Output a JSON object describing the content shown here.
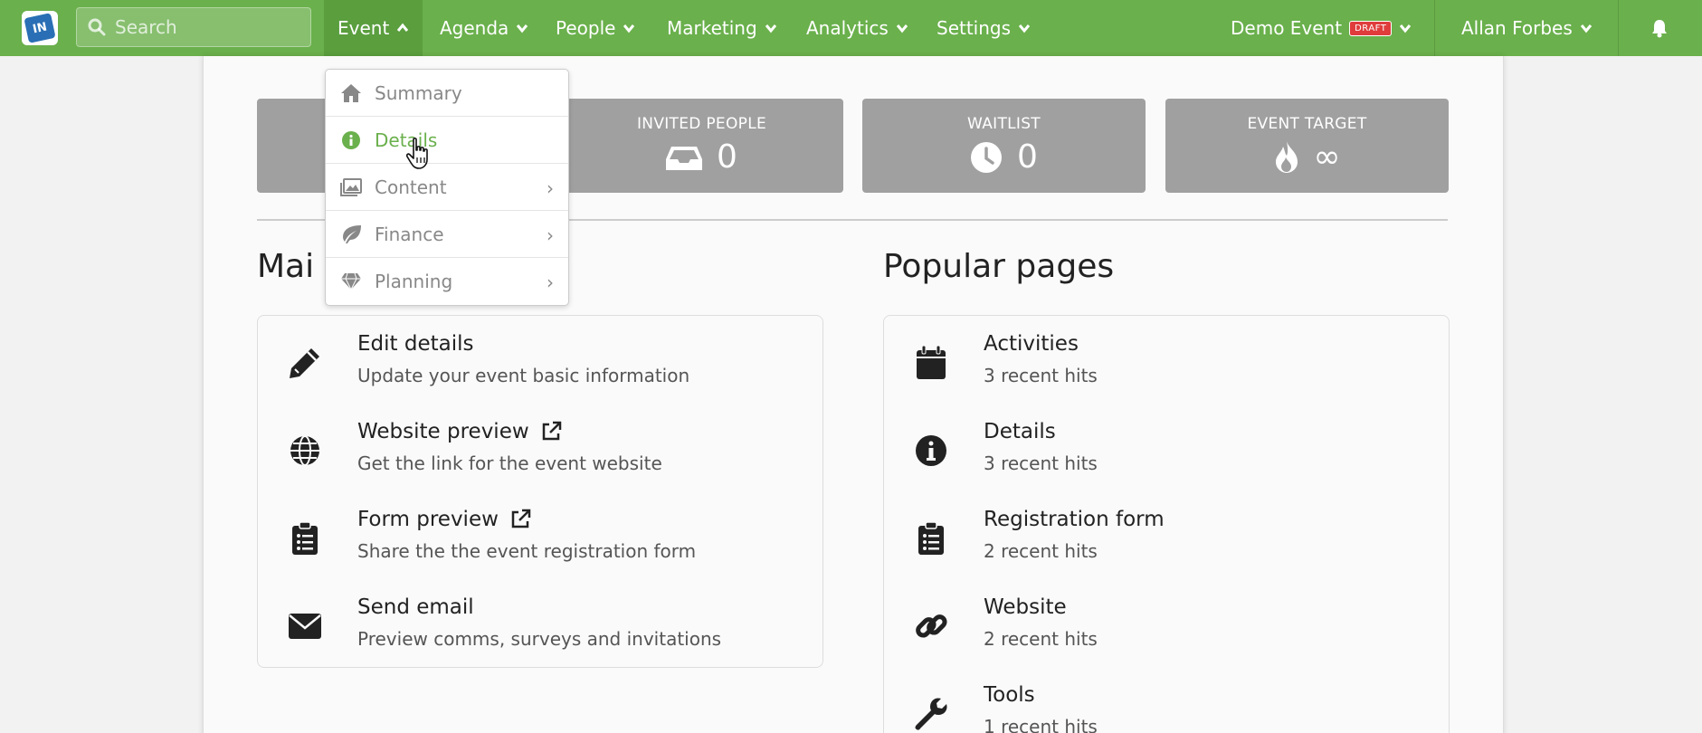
{
  "nav": {
    "search_placeholder": "Search",
    "items": [
      {
        "label": "Event"
      },
      {
        "label": "Agenda"
      },
      {
        "label": "People"
      },
      {
        "label": "Marketing"
      },
      {
        "label": "Analytics"
      },
      {
        "label": "Settings"
      }
    ],
    "event_name": "Demo Event",
    "event_badge": "DRAFT",
    "user_name": "Allan Forbes"
  },
  "dropdown": {
    "items": [
      {
        "label": "Summary",
        "icon": "home-icon"
      },
      {
        "label": "Details",
        "icon": "info-icon"
      },
      {
        "label": "Content",
        "icon": "image-icon"
      },
      {
        "label": "Finance",
        "icon": "leaf-icon"
      },
      {
        "label": "Planning",
        "icon": "diamond-icon"
      }
    ]
  },
  "stats": [
    {
      "label": "INVITED PEOPLE",
      "value": "0",
      "icon": "inbox-icon"
    },
    {
      "label": "WAITLIST",
      "value": "0",
      "icon": "clock-icon"
    },
    {
      "label": "EVENT TARGET",
      "value": "∞",
      "icon": "fire-icon"
    }
  ],
  "main_actions": {
    "title": "Mai",
    "items": [
      {
        "title": "Edit details",
        "subtitle": "Update your event basic information",
        "icon": "pencil-icon"
      },
      {
        "title": "Website preview",
        "subtitle": "Get the link for the event website",
        "icon": "globe-icon"
      },
      {
        "title": "Form preview",
        "subtitle": "Share the the event registration form",
        "icon": "clipboard-icon"
      },
      {
        "title": "Send email",
        "subtitle": "Preview comms, surveys and invitations",
        "icon": "envelope-icon"
      }
    ]
  },
  "popular_pages": {
    "title": "Popular pages",
    "items": [
      {
        "title": "Activities",
        "subtitle": "3 recent hits",
        "icon": "calendar-icon"
      },
      {
        "title": "Details",
        "subtitle": "3 recent hits",
        "icon": "info-icon"
      },
      {
        "title": "Registration form",
        "subtitle": "2 recent hits",
        "icon": "clipboard-icon"
      },
      {
        "title": "Website",
        "subtitle": "2 recent hits",
        "icon": "link-icon"
      },
      {
        "title": "Tools",
        "subtitle": "1 recent hits",
        "icon": "wrench-icon"
      }
    ]
  },
  "colors": {
    "brand_green": "#6ab04c",
    "stat_gray": "#a0a0a0",
    "draft_red": "#e03c3c"
  }
}
